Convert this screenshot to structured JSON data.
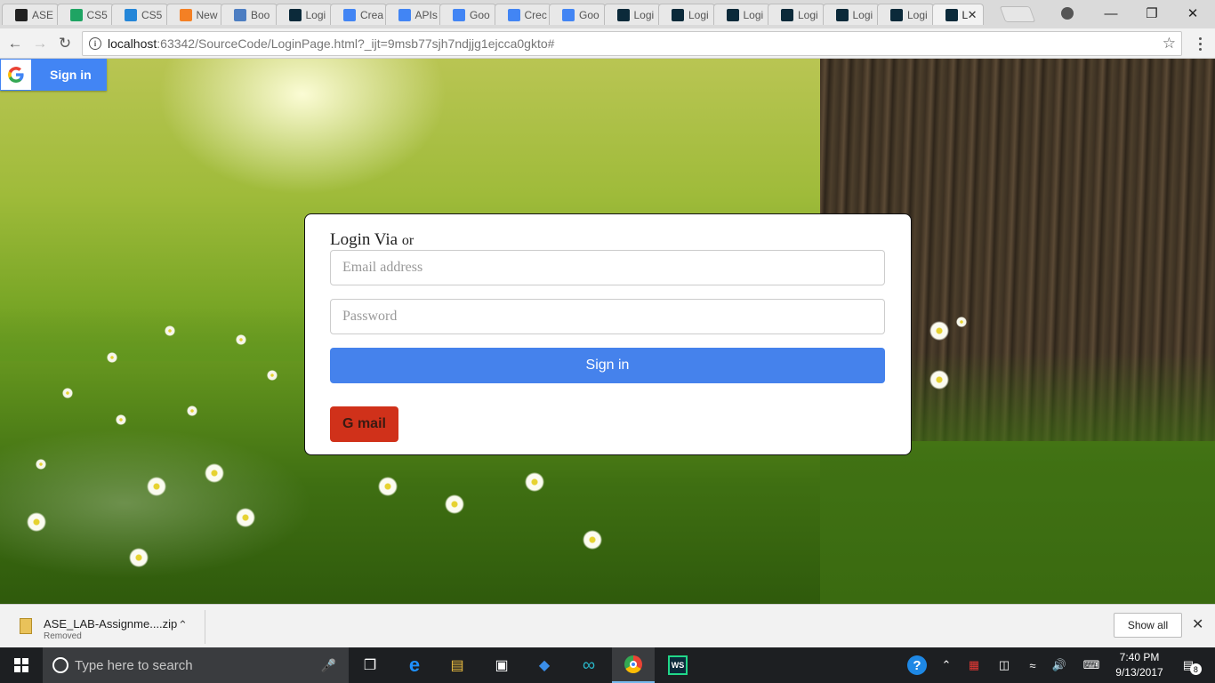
{
  "browser": {
    "tabs": [
      {
        "label": "ASE",
        "favicon": "github-icon",
        "color": "#222222"
      },
      {
        "label": "CS5",
        "favicon": "sheets-icon",
        "color": "#1fa463"
      },
      {
        "label": "CS5",
        "favicon": "box-icon",
        "color": "#2486d8"
      },
      {
        "label": "New",
        "favicon": "stackoverflow-icon",
        "color": "#f48024"
      },
      {
        "label": "Boo",
        "favicon": "bootstrap-icon",
        "color": "#4d7ec2"
      },
      {
        "label": "Logi",
        "favicon": "webstorm-icon",
        "color": "#0b2a3a"
      },
      {
        "label": "Crea",
        "favicon": "google-dev-icon",
        "color": "#4285f4"
      },
      {
        "label": "APIs",
        "favicon": "google-icon",
        "color": "#4285f4"
      },
      {
        "label": "Goo",
        "favicon": "google-dev-icon",
        "color": "#4285f4"
      },
      {
        "label": "Crec",
        "favicon": "google-icon",
        "color": "#4285f4"
      },
      {
        "label": "Goo",
        "favicon": "google-dev-icon",
        "color": "#4285f4"
      },
      {
        "label": "Logi",
        "favicon": "webstorm-icon",
        "color": "#0b2a3a"
      },
      {
        "label": "Logi",
        "favicon": "webstorm-icon",
        "color": "#0b2a3a"
      },
      {
        "label": "Logi",
        "favicon": "webstorm-icon",
        "color": "#0b2a3a"
      },
      {
        "label": "Logi",
        "favicon": "webstorm-icon",
        "color": "#0b2a3a"
      },
      {
        "label": "Logi",
        "favicon": "webstorm-icon",
        "color": "#0b2a3a"
      },
      {
        "label": "Logi",
        "favicon": "webstorm-icon",
        "color": "#0b2a3a"
      },
      {
        "label": "L",
        "favicon": "webstorm-icon",
        "color": "#0b2a3a",
        "active": true
      }
    ],
    "url_host": "localhost",
    "url_rest": ":63342/SourceCode/LoginPage.html?_ijt=9msb77sjh7ndjjg1ejcca0gkto#"
  },
  "page": {
    "google_signin_label": "Sign in",
    "login": {
      "title_main": "Login Via",
      "title_small": "or",
      "email_placeholder": "Email address",
      "password_placeholder": "Password",
      "signin_label": "Sign in",
      "gmail_label": "G mail"
    }
  },
  "downloads": {
    "filename": "ASE_LAB-Assignme....zip",
    "status": "Removed",
    "show_all": "Show all"
  },
  "taskbar": {
    "search_placeholder": "Type here to search",
    "time": "7:40 PM",
    "date": "9/13/2017",
    "notification_count": "8"
  },
  "colors": {
    "google_blue": "#4285f4",
    "signin_blue": "#4582ec",
    "gmail_red": "#d0311a"
  }
}
